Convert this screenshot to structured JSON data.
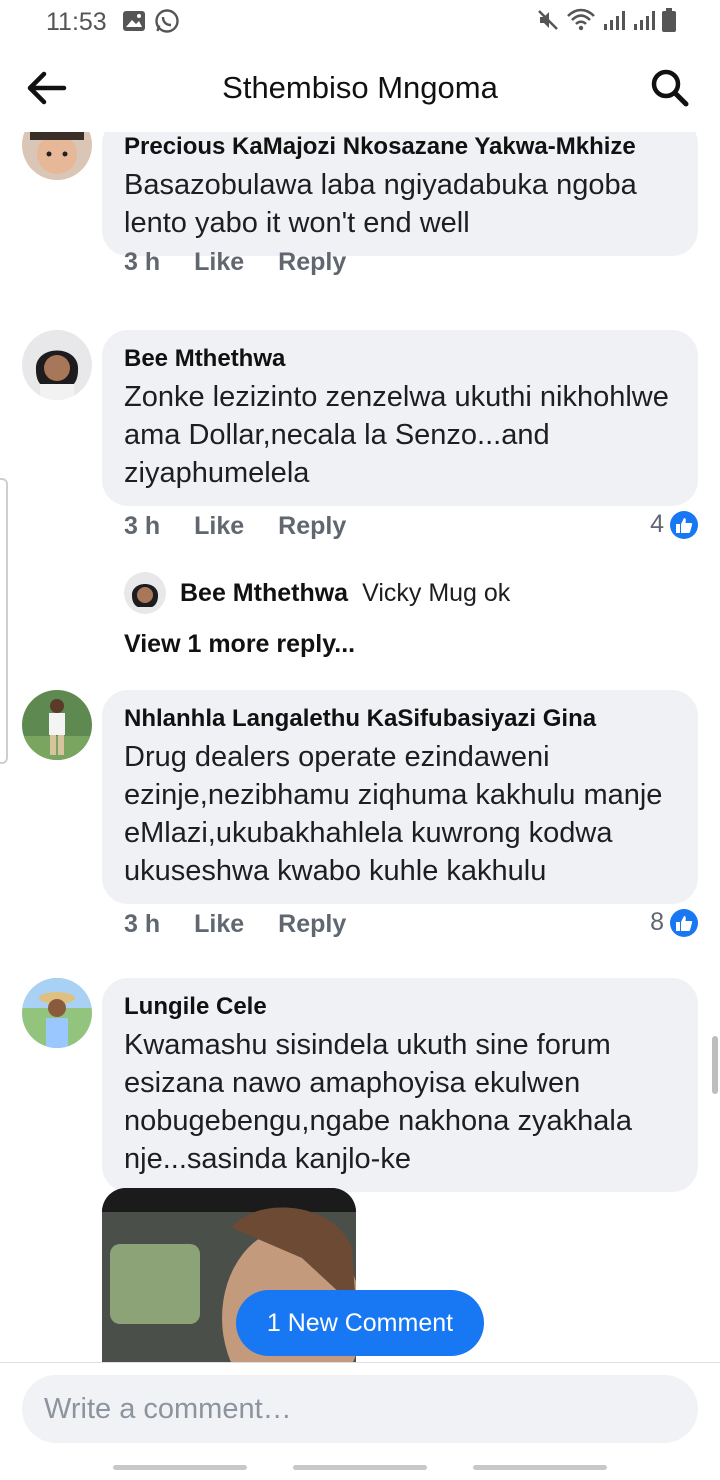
{
  "status_bar": {
    "time": "11:53",
    "left_icons": [
      "image-icon",
      "whatsapp-icon"
    ],
    "right_icons": [
      "mute-icon",
      "wifi-icon",
      "signal-icon",
      "signal-icon",
      "battery-icon"
    ]
  },
  "header": {
    "title": "Sthembiso Mngoma",
    "back_icon": "arrow-left-icon",
    "search_icon": "search-icon"
  },
  "comments": [
    {
      "author": "Precious KaMajozi Nkosazane Yakwa-Mkhize",
      "text": "Basazobulawa laba ngiyadabuka ngoba lento yabo it won't end well",
      "time": "3 h",
      "like_label": "Like",
      "reply_label": "Reply"
    },
    {
      "author": "Bee Mthethwa",
      "text": "Zonke lezizinto zenzelwa ukuthi nikhohlwe ama Dollar,necala la Senzo...and ziyaphumelela",
      "time": "3 h",
      "like_label": "Like",
      "reply_label": "Reply",
      "reactions": "4",
      "reply_preview": {
        "author": "Bee Mthethwa",
        "text": "Vicky Mug ok"
      },
      "view_more": "View 1 more reply..."
    },
    {
      "author": "Nhlanhla Langalethu KaSifubasiyazi Gina",
      "text": "Drug dealers operate ezindaweni ezinje,nezibhamu ziqhuma kakhulu manje eMlazi,ukubakhahlela kuwrong kodwa ukuseshwa kwabo kuhle kakhulu",
      "time": "3 h",
      "like_label": "Like",
      "reply_label": "Reply",
      "reactions": "8"
    },
    {
      "author": "Lungile Cele",
      "text": "Kwamashu sisindela ukuth sine forum esizana nawo amaphoyisa ekulwen nobugebengu,ngabe nakhona zyakhala nje...sasinda kanjlo-ke"
    }
  ],
  "new_comment_label": "1 New Comment",
  "composer": {
    "placeholder": "Write a comment…"
  },
  "colors": {
    "accent": "#1877f2",
    "bubble": "#eff1f4",
    "meta": "#606770"
  }
}
